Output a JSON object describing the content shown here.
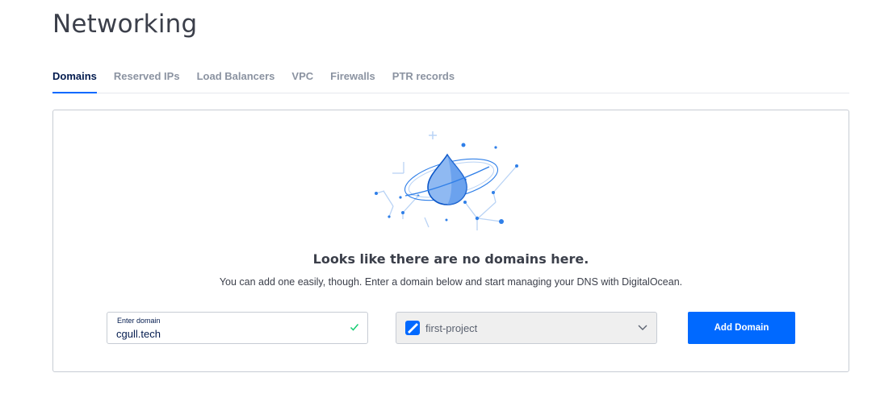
{
  "page": {
    "title": "Networking"
  },
  "tabs": [
    {
      "label": "Domains",
      "active": true
    },
    {
      "label": "Reserved IPs",
      "active": false
    },
    {
      "label": "Load Balancers",
      "active": false
    },
    {
      "label": "VPC",
      "active": false
    },
    {
      "label": "Firewalls",
      "active": false
    },
    {
      "label": "PTR records",
      "active": false
    }
  ],
  "empty_state": {
    "illustration": "water-drop-planet-icon",
    "heading": "Looks like there are no domains here.",
    "subtext": "You can add one easily, though. Enter a domain below and start managing your DNS with DigitalOcean."
  },
  "form": {
    "domain_label": "Enter domain",
    "domain_value": "cgull.tech",
    "domain_valid_icon": "check-icon",
    "project_value": "first-project",
    "project_icon": "project-icon",
    "add_button_label": "Add Domain"
  },
  "colors": {
    "accent": "#0069ff",
    "valid": "#15cd72",
    "text": "#031b4e"
  }
}
